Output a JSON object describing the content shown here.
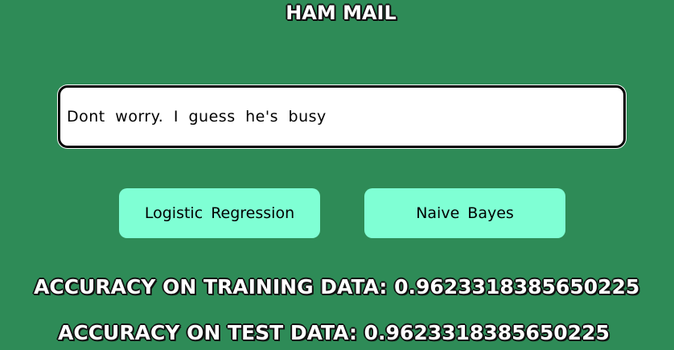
{
  "header": {
    "title": "HAM MAIL"
  },
  "message_input": {
    "value": "Dont worry. I guess he's busy"
  },
  "buttons": {
    "logistic_regression": "Logistic Regression",
    "naive_bayes": "Naive Bayes"
  },
  "results": {
    "training_accuracy": "ACCURACY ON TRAINING DATA: 0.9623318385650225",
    "test_accuracy": "ACCURACY ON TEST DATA: 0.9623318385650225"
  },
  "colors": {
    "background": "#2e8b57",
    "button": "#7fffd4",
    "input_bg": "#ffffff"
  }
}
